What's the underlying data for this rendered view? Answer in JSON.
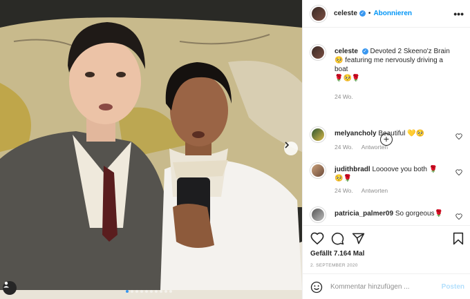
{
  "post": {
    "author": "celeste",
    "follow_label": "Abonnieren",
    "more_label": "•••",
    "dots_count": 10,
    "dots_active": 0
  },
  "caption": {
    "username": "celeste",
    "text": "Devoted 2 Skeeno'z Brain 🥺 featuring me nervously driving a boat",
    "emoji_line": "🌹🥺🌹",
    "time": "24 Wo."
  },
  "comments": [
    {
      "username": "melyancholy",
      "text": "Beautiful 💛🥺",
      "time": "24 Wo.",
      "reply_label": "Antworten"
    },
    {
      "username": "judithbradl",
      "text": "Loooove you both 🌹",
      "text2": "🥺🌹",
      "time": "24 Wo.",
      "reply_label": "Antworten"
    },
    {
      "username": "patricia_palmer09",
      "text": "So gorgeous🌹"
    }
  ],
  "likes_text": "Gefällt 7.164 Mal",
  "date_text": "2. SEPTEMBER 2020",
  "composer": {
    "placeholder": "Kommentar hinzufügen ...",
    "post_label": "Posten"
  },
  "icons": {
    "verified": "verified-badge-icon",
    "like": "heart-icon",
    "comment": "comment-bubble-icon",
    "share": "paper-plane-icon",
    "save": "bookmark-icon",
    "emoji": "smiley-icon",
    "load_more": "plus-circle-icon",
    "next": "chevron-right-icon",
    "tagged_user": "user-tag-icon"
  },
  "colors": {
    "accent": "#0095f6",
    "post_disabled": "#b2dffc",
    "muted": "#8e8e8e",
    "text": "#262626"
  }
}
